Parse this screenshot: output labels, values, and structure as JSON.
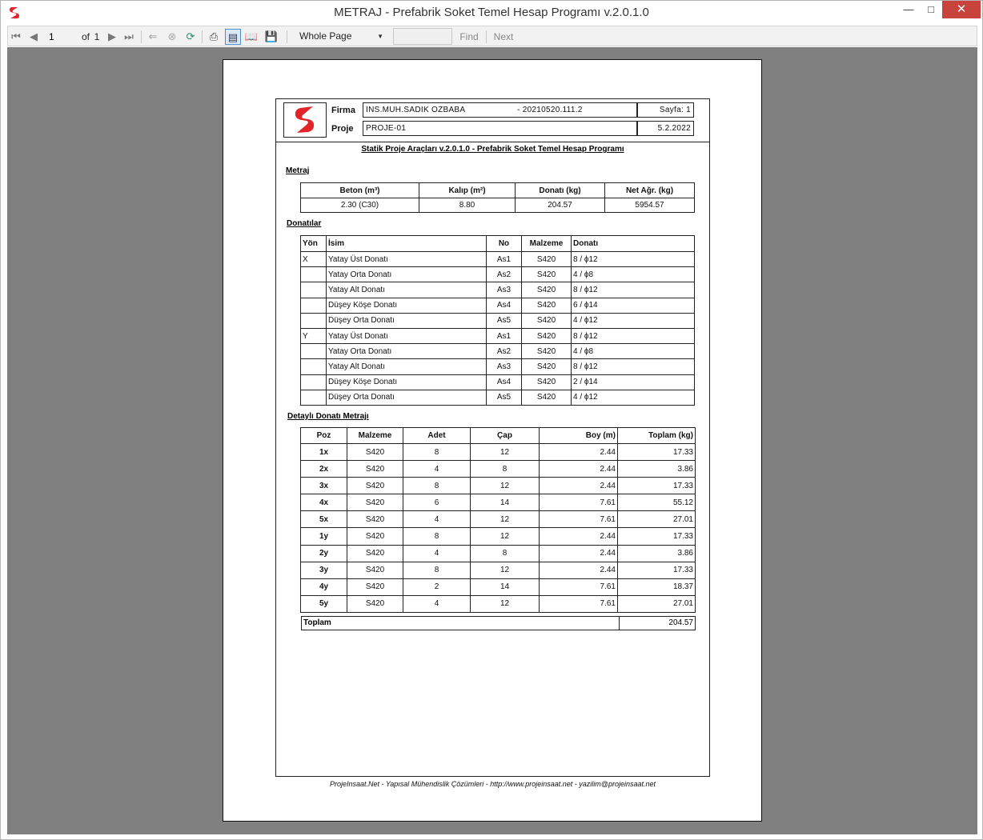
{
  "window": {
    "title": "METRAJ - Prefabrik Soket Temel Hesap Programı v.2.0.1.0"
  },
  "toolbar": {
    "page_value": "1",
    "page_of": "of",
    "page_total": "1",
    "zoom": "Whole Page",
    "find_value": "",
    "find_label": "Find",
    "next_label": "Next"
  },
  "report": {
    "firma_label": "Firma",
    "firma_value": "INS.MUH.SADIK OZBABA",
    "firma_code": "- 20210520.111.2",
    "proje_label": "Proje",
    "proje_value": "PROJE-01",
    "sayfa": "Sayfa: 1",
    "date": "5.2.2022",
    "title": "Statik Proje Araçları v.2.0.1.0 - Prefabrik Soket Temel Hesap Programı",
    "metraj_heading": "Metraj",
    "metraj_headers": [
      "Beton (m³)",
      "Kalıp (m²)",
      "Donatı (kg)",
      "Net Ağr. (kg)"
    ],
    "metraj_values": [
      "2.30 (C30)",
      "8.80",
      "204.57",
      "5954.57"
    ],
    "donatilar_heading": "Donatılar",
    "donatilar_headers": [
      "Yön",
      "İsim",
      "No",
      "Malzeme",
      "Donatı"
    ],
    "donatilar_rows": [
      [
        "X",
        "Yatay Üst Donatı",
        "As1",
        "S420",
        "8 / ϕ12"
      ],
      [
        "",
        "Yatay Orta Donatı",
        "As2",
        "S420",
        "4 / ϕ8"
      ],
      [
        "",
        "Yatay Alt Donatı",
        "As3",
        "S420",
        "8 / ϕ12"
      ],
      [
        "",
        "Düşey Köşe Donatı",
        "As4",
        "S420",
        "6 / ϕ14"
      ],
      [
        "",
        "Düşey Orta Donatı",
        "As5",
        "S420",
        "4 / ϕ12"
      ],
      [
        "Y",
        "Yatay Üst Donatı",
        "As1",
        "S420",
        "8 / ϕ12"
      ],
      [
        "",
        "Yatay Orta Donatı",
        "As2",
        "S420",
        "4 / ϕ8"
      ],
      [
        "",
        "Yatay Alt Donatı",
        "As3",
        "S420",
        "8 / ϕ12"
      ],
      [
        "",
        "Düşey Köşe Donatı",
        "As4",
        "S420",
        "2 / ϕ14"
      ],
      [
        "",
        "Düşey Orta Donatı",
        "As5",
        "S420",
        "4 / ϕ12"
      ]
    ],
    "detay_heading": "Detaylı Donatı Metrajı",
    "detay_headers": [
      "Poz",
      "Malzeme",
      "Adet",
      "Çap",
      "Boy (m)",
      "Toplam (kg)"
    ],
    "detay_rows": [
      [
        "1x",
        "S420",
        "8",
        "12",
        "2.44",
        "17.33"
      ],
      [
        "2x",
        "S420",
        "4",
        "8",
        "2.44",
        "3.86"
      ],
      [
        "3x",
        "S420",
        "8",
        "12",
        "2.44",
        "17.33"
      ],
      [
        "4x",
        "S420",
        "6",
        "14",
        "7.61",
        "55.12"
      ],
      [
        "5x",
        "S420",
        "4",
        "12",
        "7.61",
        "27.01"
      ],
      [
        "1y",
        "S420",
        "8",
        "12",
        "2.44",
        "17.33"
      ],
      [
        "2y",
        "S420",
        "4",
        "8",
        "2.44",
        "3.86"
      ],
      [
        "3y",
        "S420",
        "8",
        "12",
        "2.44",
        "17.33"
      ],
      [
        "4y",
        "S420",
        "2",
        "14",
        "7.61",
        "18.37"
      ],
      [
        "5y",
        "S420",
        "4",
        "12",
        "7.61",
        "27.01"
      ]
    ],
    "toplam_label": "Toplam",
    "toplam_value": "204.57",
    "footer": "ProjeInsaat.Net - Yapısal Mühendislik Çözümleri - http://www.projeinsaat.net - yazilim@projeinsaat.net"
  },
  "colors": {
    "accent": "#e0242a",
    "viewer_bg": "#808080",
    "close_btn": "#c7433b"
  }
}
